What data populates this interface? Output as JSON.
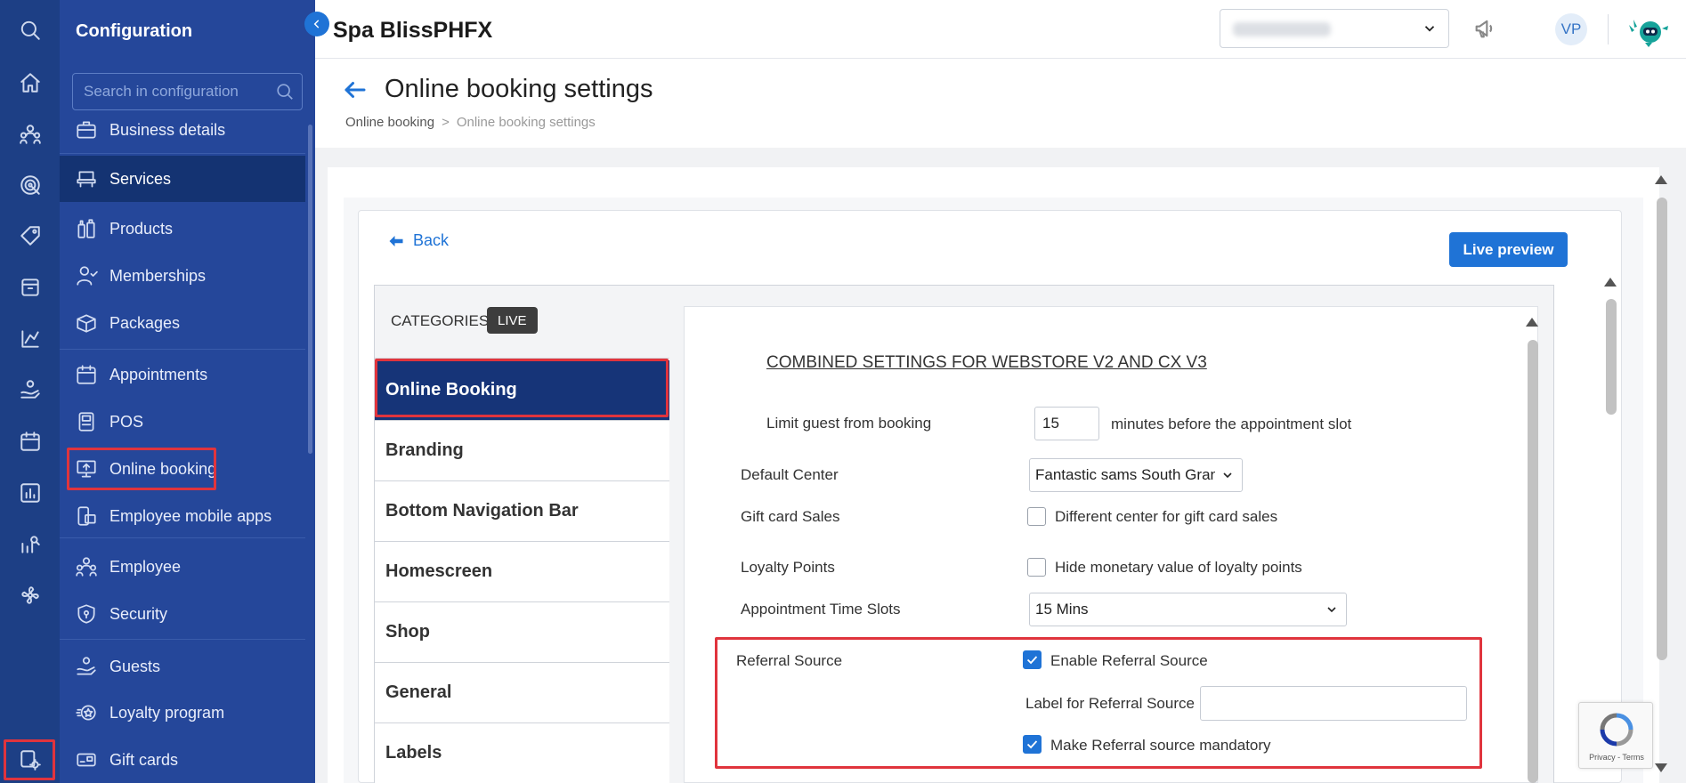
{
  "sidebar": {
    "title": "Configuration",
    "search_placeholder": "Search in configuration",
    "items": [
      {
        "label": "Business details",
        "icon": "briefcase-icon"
      },
      {
        "label": "Services",
        "icon": "salon-chair-icon"
      },
      {
        "label": "Products",
        "icon": "bottles-icon"
      },
      {
        "label": "Memberships",
        "icon": "member-icon"
      },
      {
        "label": "Packages",
        "icon": "box-icon"
      },
      {
        "label": "Appointments",
        "icon": "calendar-icon"
      },
      {
        "label": "POS",
        "icon": "pos-icon"
      },
      {
        "label": "Online booking",
        "icon": "monitor-icon"
      },
      {
        "label": "Employee mobile apps",
        "icon": "mobile-app-icon"
      },
      {
        "label": "Employee",
        "icon": "employee-icon"
      },
      {
        "label": "Security",
        "icon": "shield-icon"
      },
      {
        "label": "Guests",
        "icon": "guests-icon"
      },
      {
        "label": "Loyalty program",
        "icon": "loyalty-icon"
      },
      {
        "label": "Gift cards",
        "icon": "gift-card-icon"
      }
    ]
  },
  "topbar": {
    "brand": "Spa BlissPHFX",
    "avatar_initials": "VP"
  },
  "page": {
    "title": "Online booking settings",
    "breadcrumb": {
      "parent": "Online booking",
      "separator": ">",
      "current": "Online booking settings"
    },
    "back_label": "Back",
    "live_preview_label": "Live preview"
  },
  "categories": {
    "header": "CATEGORIES",
    "badge": "LIVE",
    "items": [
      "Online Booking",
      "Branding",
      "Bottom Navigation Bar",
      "Homescreen",
      "Shop",
      "General",
      "Labels"
    ],
    "active_index": 0
  },
  "settings": {
    "section_title": "COMBINED SETTINGS FOR WEBSTORE V2 AND CX V3",
    "limit_guest": {
      "label": "Limit guest from booking",
      "value": "15",
      "suffix": "minutes before the appointment slot"
    },
    "default_center": {
      "label": "Default Center",
      "value": "Fantastic sams South Granville"
    },
    "gift_card": {
      "label": "Gift card Sales",
      "option": "Different center for gift card sales",
      "checked": false
    },
    "loyalty": {
      "label": "Loyalty Points",
      "option": "Hide monetary value of loyalty points",
      "checked": false
    },
    "time_slots": {
      "label": "Appointment Time Slots",
      "value": "15 Mins"
    },
    "referral": {
      "label": "Referral Source",
      "enable_label": "Enable Referral Source",
      "enable_checked": true,
      "field_label": "Label for Referral Source",
      "field_value": "",
      "mandatory_label": "Make Referral source mandatory",
      "mandatory_checked": true
    }
  },
  "recaptcha": {
    "terms": "Privacy - Terms"
  },
  "colors": {
    "rail": "#1d3f85",
    "sidebar": "#25479a",
    "active": "#143372",
    "accent": "#1f73d6",
    "highlight": "#e0343d"
  }
}
